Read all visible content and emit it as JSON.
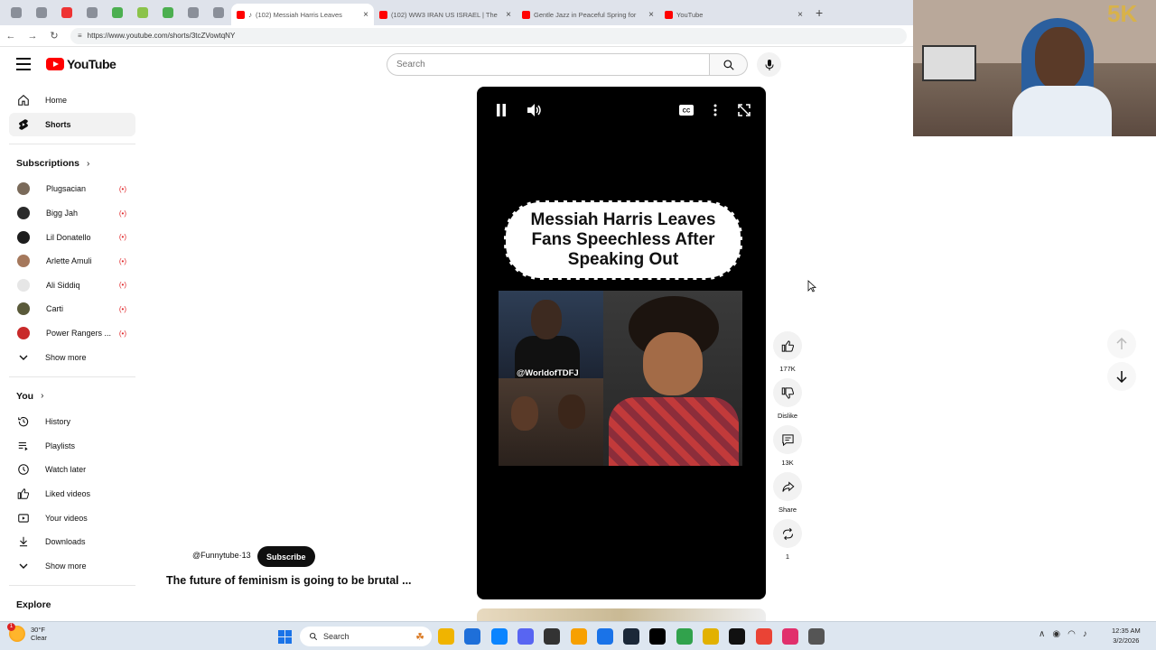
{
  "browser": {
    "pinned_tabs": [
      "#8a8f99",
      "#8a8f99",
      "#e33",
      "#8a8f99",
      "#4caf50",
      "#8bc34a",
      "#4caf50",
      "#8a8f99",
      "#8a8f99"
    ],
    "tabs": [
      {
        "title": "(102) Messiah Harris Leaves",
        "active": true,
        "fav_color": "#ff0000"
      },
      {
        "title": "(102) WW3 IRAN US ISRAEL | The",
        "active": false,
        "fav_color": "#ff0000"
      },
      {
        "title": "Gentle Jazz in Peaceful Spring for",
        "active": false,
        "fav_color": "#ff0000"
      },
      {
        "title": "YouTube",
        "active": false,
        "fav_color": "#ff0000"
      }
    ],
    "url": "https://www.youtube.com/shorts/3tcZVowtqNY"
  },
  "header": {
    "logo_text": "YouTube",
    "search_placeholder": "Search"
  },
  "sidebar": {
    "main": [
      {
        "label": "Home",
        "icon": "home-icon",
        "active": false
      },
      {
        "label": "Shorts",
        "icon": "shorts-icon",
        "active": true
      }
    ],
    "subscriptions_title": "Subscriptions",
    "subscriptions": [
      {
        "label": "Plugsacian",
        "color": "#7a6a5a"
      },
      {
        "label": "Bigg Jah",
        "color": "#2a2a2a"
      },
      {
        "label": "Lil Donatello",
        "color": "#1d1d1d"
      },
      {
        "label": "Arlette Amuli",
        "color": "#a5785c"
      },
      {
        "label": "Ali Siddiq",
        "color": "#e6e6e6"
      },
      {
        "label": "Carti",
        "color": "#5a5a3a"
      },
      {
        "label": "Power Rangers ...",
        "color": "#c92a2a"
      }
    ],
    "show_more": "Show more",
    "you_title": "You",
    "you_items": [
      {
        "label": "History",
        "icon": "history-icon"
      },
      {
        "label": "Playlists",
        "icon": "playlists-icon"
      },
      {
        "label": "Watch later",
        "icon": "watch-later-icon"
      },
      {
        "label": "Liked videos",
        "icon": "liked-videos-icon"
      },
      {
        "label": "Your videos",
        "icon": "your-videos-icon"
      },
      {
        "label": "Downloads",
        "icon": "downloads-icon"
      }
    ],
    "show_more_2": "Show more",
    "explore_title": "Explore"
  },
  "short": {
    "headline": "Messiah Harris Leaves Fans Speechless After Speaking Out",
    "watermark": "@WorldofTDFJ",
    "channel": "@Funnytube·13",
    "subscribe": "Subscribe",
    "title": "The future of feminism is going to be brutal ..."
  },
  "actions": {
    "likes": "177K",
    "dislike": "Dislike",
    "comments": "13K",
    "share": "Share",
    "remix": "1"
  },
  "taskbar": {
    "temp": "30°F",
    "condition": "Clear",
    "weather_badge": "1",
    "search": "Search",
    "time": "12:35 AM",
    "date": "3/2/2026",
    "apps": [
      "#f0b400",
      "#1e6fd9",
      "#0a84ff",
      "#5865f2",
      "#333333",
      "#f7a000",
      "#1a73e8",
      "#1b2838",
      "#000000",
      "#31a24c",
      "#e2b100",
      "#111111",
      "#ea4335",
      "#e1306c",
      "#555555"
    ]
  }
}
